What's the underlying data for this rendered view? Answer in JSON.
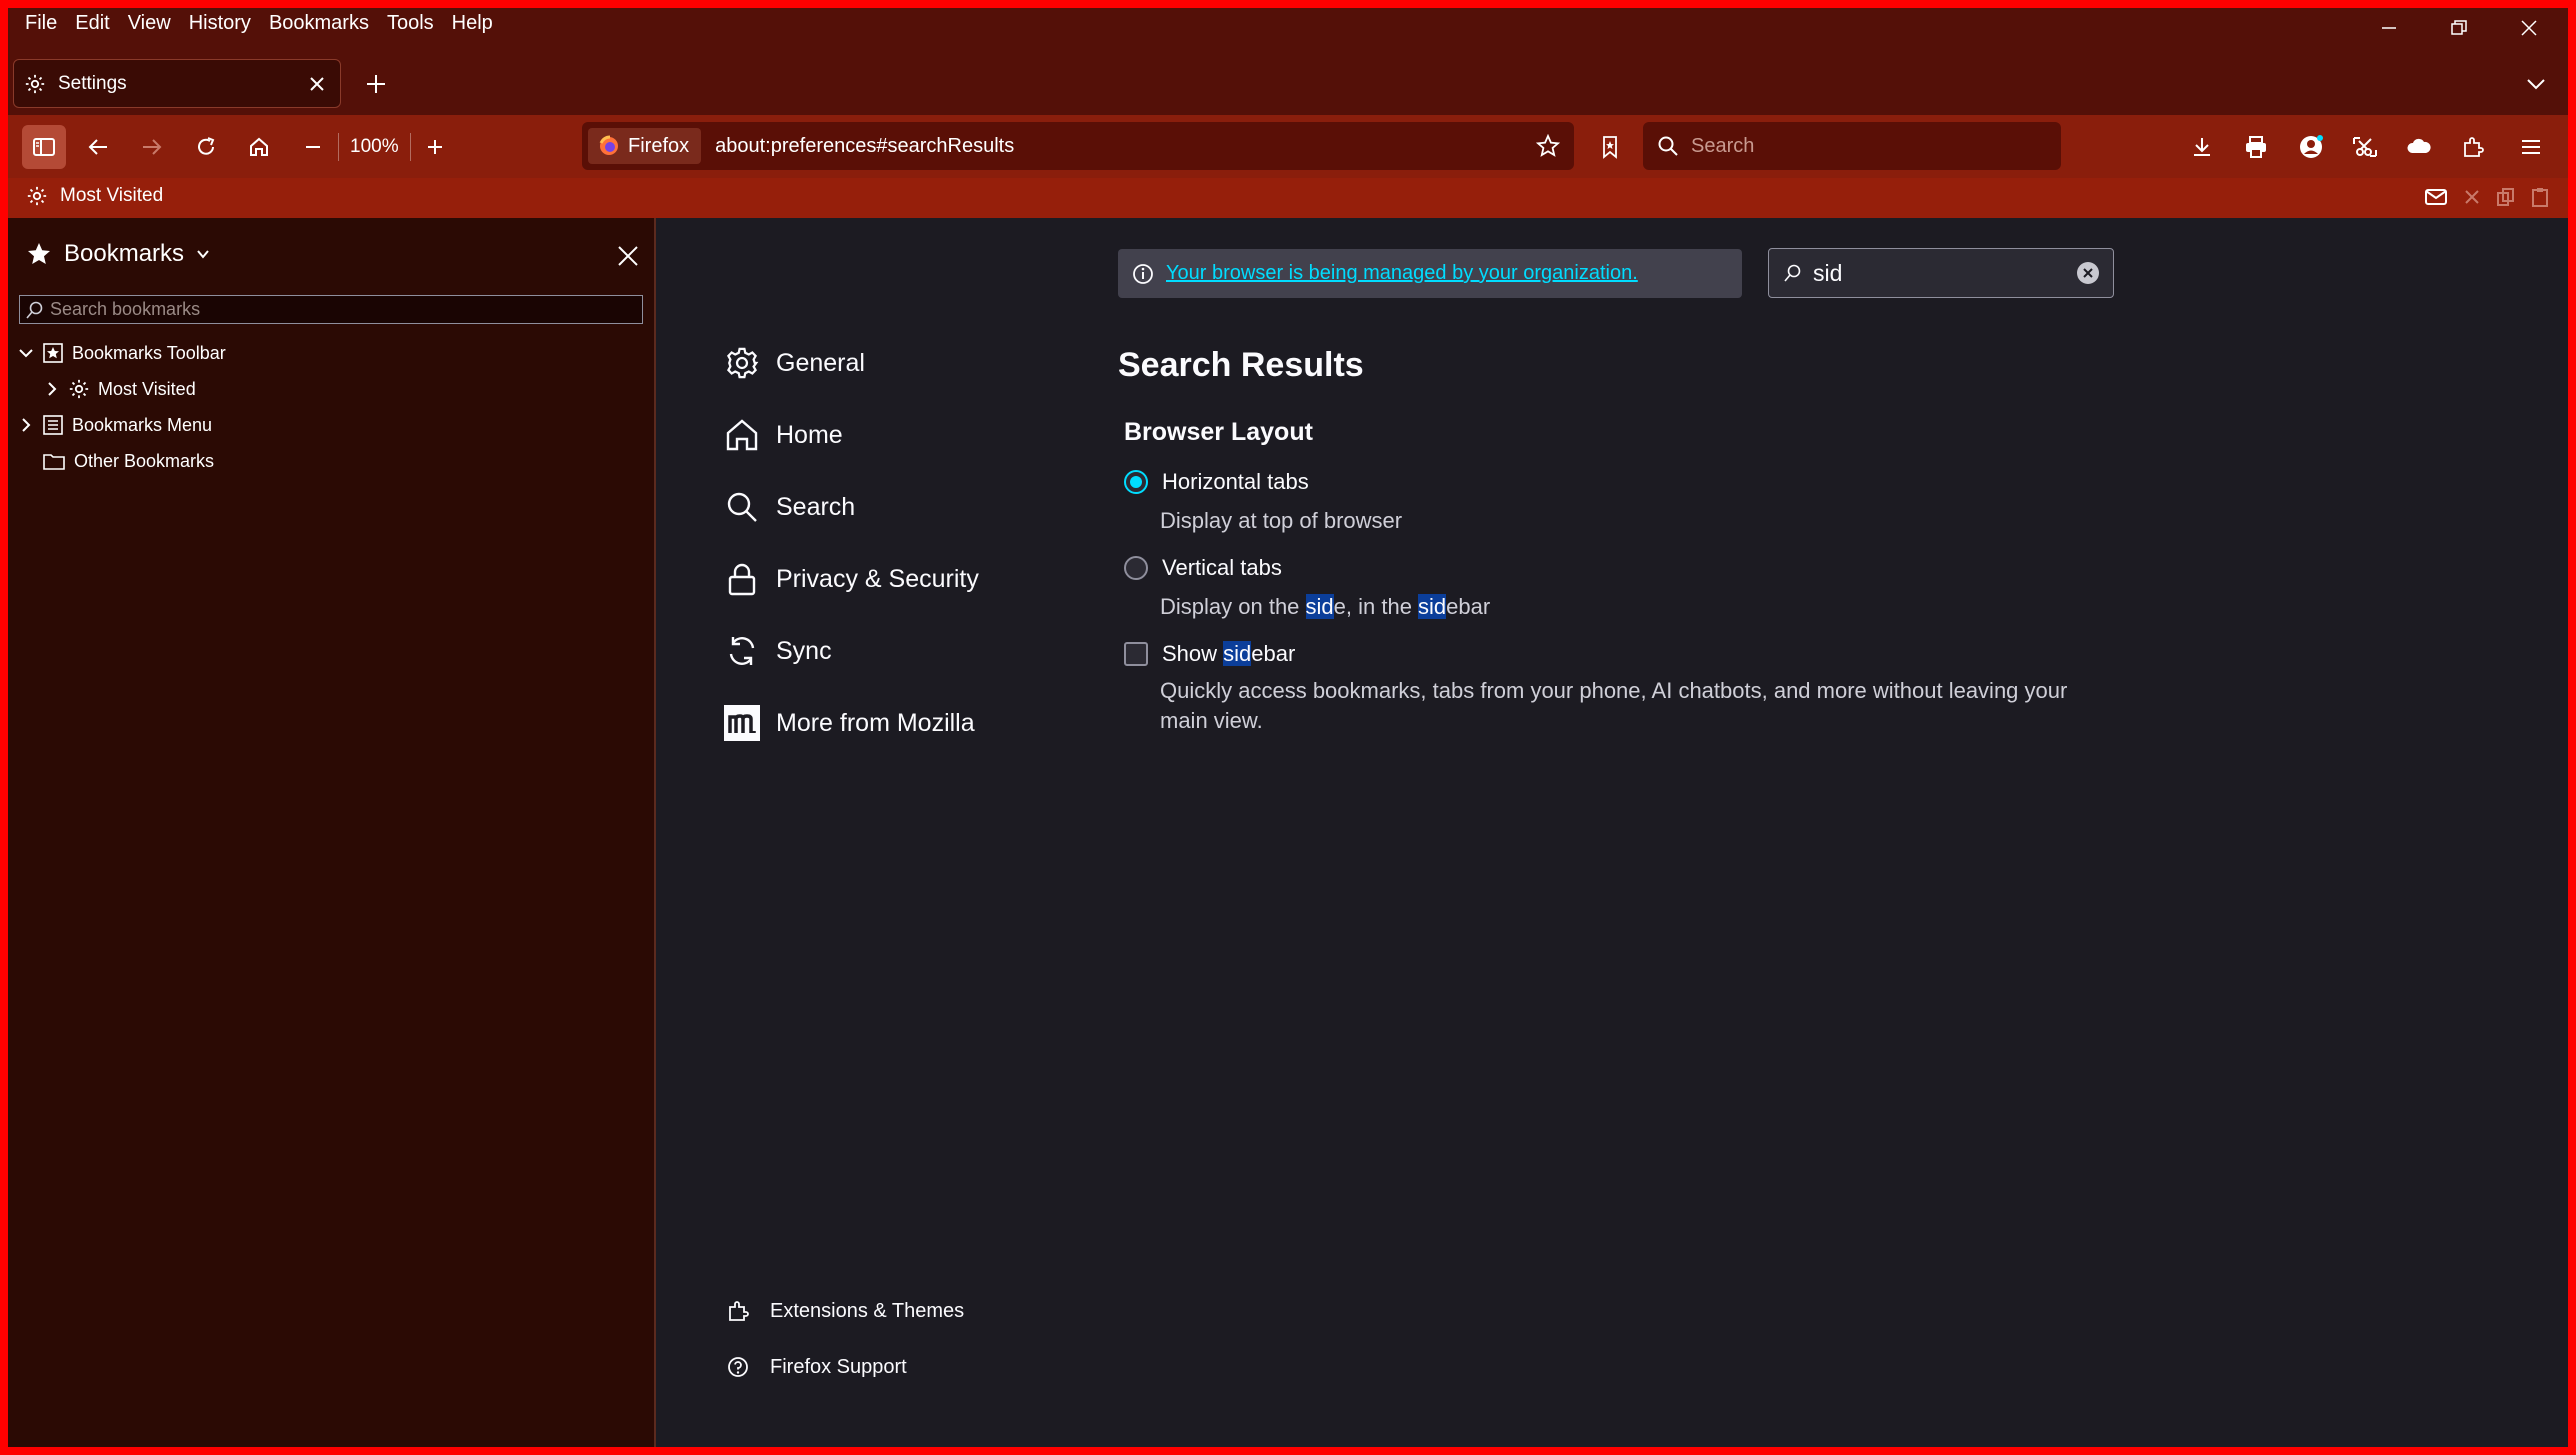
{
  "menubar": [
    "File",
    "Edit",
    "View",
    "History",
    "Bookmarks",
    "Tools",
    "Help"
  ],
  "tab": {
    "title": "Settings"
  },
  "toolbar": {
    "zoom": "100%"
  },
  "urlbar": {
    "identity_label": "Firefox",
    "url": "about:preferences#searchResults"
  },
  "searchbar": {
    "placeholder": "Search"
  },
  "bookmarks_toolbar": {
    "item": "Most Visited"
  },
  "sidebar": {
    "title": "Bookmarks",
    "search_placeholder": "Search bookmarks",
    "tree": {
      "toolbar": "Bookmarks Toolbar",
      "most_visited": "Most Visited",
      "menu": "Bookmarks Menu",
      "other": "Other Bookmarks"
    }
  },
  "prefs": {
    "policy_notice": "Your browser is being managed by your organization.",
    "search_value": "sid",
    "categories": [
      "General",
      "Home",
      "Search",
      "Privacy & Security",
      "Sync",
      "More from Mozilla"
    ],
    "footer": [
      "Extensions & Themes",
      "Firefox Support"
    ],
    "heading": "Search Results",
    "section": "Browser Layout",
    "options": {
      "horizontal_label": "Horizontal tabs",
      "horizontal_desc": "Display at top of browser",
      "vertical_label": "Vertical tabs",
      "vertical_desc_parts": [
        "Display on the ",
        "sid",
        "e, in the ",
        "sid",
        "ebar"
      ],
      "sidebar_label_parts": [
        "Show ",
        "sid",
        "ebar"
      ],
      "sidebar_desc_line1": "Quickly access bookmarks, tabs from your phone, AI chatbots, and more without leaving your",
      "sidebar_desc_line2": "main view."
    }
  },
  "colors": {
    "accent": "#00ddff",
    "highlight": "#0b3e9a",
    "toolbar": "#8a1e0c"
  }
}
